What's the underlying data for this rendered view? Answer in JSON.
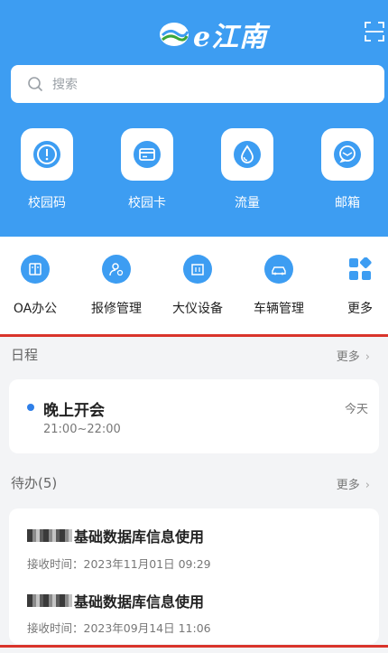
{
  "header": {
    "logo_text": "e江南",
    "search_placeholder": "搜索"
  },
  "quick_tiles": [
    {
      "label": "校园码",
      "icon": "campus-code-icon"
    },
    {
      "label": "校园卡",
      "icon": "campus-card-icon"
    },
    {
      "label": "流量",
      "icon": "data-drop-icon"
    },
    {
      "label": "邮箱",
      "icon": "mail-icon"
    }
  ],
  "services": [
    {
      "label": "OA办公",
      "icon": "oa-office-icon"
    },
    {
      "label": "报修管理",
      "icon": "repair-icon"
    },
    {
      "label": "大仪设备",
      "icon": "equipment-icon"
    },
    {
      "label": "车辆管理",
      "icon": "vehicle-icon"
    },
    {
      "label": "更多",
      "icon": "grid-more-icon"
    }
  ],
  "schedule": {
    "section_title": "日程",
    "more_label": "更多",
    "item": {
      "title": "晚上开会",
      "time": "21:00~22:00",
      "day": "今天"
    }
  },
  "todo": {
    "section_title": "待办(5)",
    "more_label": "更多",
    "items": [
      {
        "title": "基础数据库信息使用",
        "received": "接收时间：2023年11月01日 09:29"
      },
      {
        "title": "基础数据库信息使用",
        "received": "接收时间：2023年09月14日 11:06"
      }
    ]
  },
  "colors": {
    "brand_blue": "#3d9df2",
    "highlight_red": "#d9342b",
    "dot_blue": "#2f7fe8"
  }
}
